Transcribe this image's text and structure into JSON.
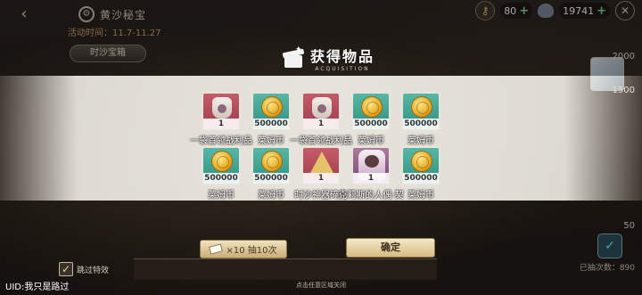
{
  "background": {
    "title": "黄沙秘宝",
    "period": "活动时间：11.7-11.27",
    "tab_label": "时沙宝箱",
    "scale_ticks": [
      "2000",
      "1500",
      "50"
    ],
    "drawn_count": "已抽次数：890",
    "skip_label": "跳过特效"
  },
  "topbar": {
    "currency1_value": "80",
    "currency2_value": "19741",
    "plus_symbol": "+"
  },
  "modal": {
    "title": "获得物品",
    "subtitle": "ACQUISITION",
    "items": [
      {
        "name": "一袋首领战利品",
        "qty": "1",
        "kind": "pouch"
      },
      {
        "name": "莱姆币",
        "qty": "500000",
        "kind": "coin"
      },
      {
        "name": "一袋首领战利品",
        "qty": "1",
        "kind": "pouch"
      },
      {
        "name": "莱姆币",
        "qty": "500000",
        "kind": "coin"
      },
      {
        "name": "莱姆币",
        "qty": "500000",
        "kind": "coin"
      },
      {
        "name": "莱姆币",
        "qty": "500000",
        "kind": "coin"
      },
      {
        "name": "莱姆币",
        "qty": "500000",
        "kind": "coin"
      },
      {
        "name": "时沙神器碎片",
        "qty": "1",
        "kind": "pyramid"
      },
      {
        "name": "克莉斯的人偶·契",
        "qty": "1",
        "kind": "doll"
      },
      {
        "name": "莱姆币",
        "qty": "500000",
        "kind": "coin"
      }
    ],
    "draw_button": "×10 抽10次",
    "confirm_button": "确定",
    "hint": "点击任意区域关闭"
  },
  "uid": "UID:我只是路过"
}
